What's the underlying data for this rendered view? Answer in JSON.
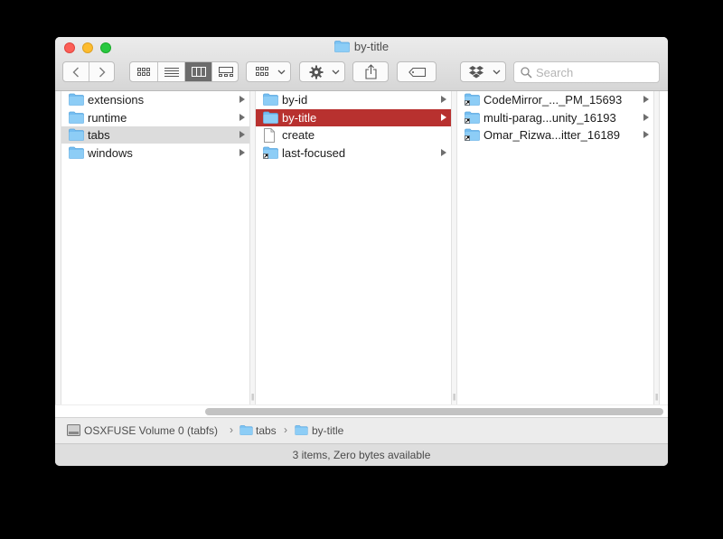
{
  "window": {
    "title": "by-title",
    "title_icon": "folder-icon"
  },
  "toolbar": {
    "back_icon": "chevron-left-icon",
    "forward_icon": "chevron-right-icon",
    "view_modes": [
      "icon-view-icon",
      "list-view-icon",
      "column-view-icon",
      "gallery-view-icon"
    ],
    "active_view": "column-view",
    "search_placeholder": "Search"
  },
  "columns": [
    {
      "items": [
        {
          "name": "extensions",
          "type": "folder",
          "has_children": true,
          "selected": false
        },
        {
          "name": "runtime",
          "type": "folder",
          "has_children": true,
          "selected": false
        },
        {
          "name": "tabs",
          "type": "folder",
          "has_children": true,
          "selected": true
        },
        {
          "name": "windows",
          "type": "folder",
          "has_children": true,
          "selected": false
        }
      ]
    },
    {
      "items": [
        {
          "name": "by-id",
          "type": "folder",
          "has_children": true,
          "selected": false
        },
        {
          "name": "by-title",
          "type": "folder",
          "has_children": true,
          "selected": true
        },
        {
          "name": "create",
          "type": "file",
          "has_children": false,
          "selected": false
        },
        {
          "name": "last-focused",
          "type": "alias-folder",
          "has_children": true,
          "selected": false
        }
      ]
    },
    {
      "items": [
        {
          "name": "CodeMirror_..._PM_15693",
          "type": "alias-folder",
          "has_children": true,
          "selected": false
        },
        {
          "name": "multi-parag...unity_16193",
          "type": "alias-folder",
          "has_children": true,
          "selected": false
        },
        {
          "name": "Omar_Rizwa...itter_16189",
          "type": "alias-folder",
          "has_children": true,
          "selected": false
        }
      ]
    }
  ],
  "path_bar": {
    "segments": [
      "OSXFUSE Volume 0 (tabfs)",
      "tabs",
      "by-title"
    ]
  },
  "status": {
    "text": "3 items, Zero bytes available"
  },
  "colors": {
    "selection_active": "#b8312f",
    "selection_inactive": "#dcdcdc",
    "folder": "#5fb5f0"
  }
}
